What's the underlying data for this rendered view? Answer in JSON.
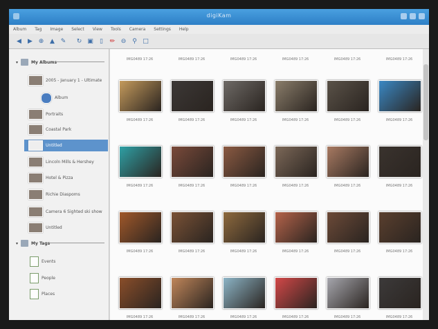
{
  "window": {
    "title": "digiKam"
  },
  "menu": [
    "Album",
    "Tag",
    "Image",
    "Select",
    "View",
    "Tools",
    "Camera",
    "Settings",
    "Help"
  ],
  "toolbar": [
    "back-icon",
    "forward-icon",
    "zoom-in-icon",
    "up-icon",
    "edit-icon",
    "rotate-icon",
    "crop-icon",
    "slideshow-icon",
    "red-eye-icon",
    "zoom-out-icon",
    "search-icon",
    "fullscreen-icon"
  ],
  "sidebar": {
    "albums_header": "My Albums",
    "albums": [
      {
        "label": "2005 - January 1 - Ultimate"
      },
      {
        "label": "Album"
      },
      {
        "label": "Portraits"
      },
      {
        "label": "Coastal Park"
      },
      {
        "label": "Untitled"
      },
      {
        "label": "Lincoln Mills & Hershey"
      },
      {
        "label": "Hotel & Pizza"
      },
      {
        "label": "Richie Diaspoms"
      },
      {
        "label": "Camera 6 Sighted ski show"
      },
      {
        "label": "Untitled"
      }
    ],
    "tags_header": "My Tags",
    "tags": [
      {
        "label": "Events"
      },
      {
        "label": "People"
      },
      {
        "label": "Places"
      }
    ]
  },
  "grid": {
    "caption": "IMG0489 17:26",
    "rows": [
      [
        "#c49a5c",
        "#3c3836",
        "#6e6a66",
        "#8a7d6a",
        "#5a5248",
        "#3a88c4"
      ],
      [
        "#2fa0a5",
        "#7a4a3a",
        "#8b5a42",
        "#7c6858",
        "#a87a62",
        "#3a332e"
      ],
      [
        "#a0582a",
        "#7a5236",
        "#8e6a3e",
        "#b4634a",
        "#6c4a38",
        "#5a3f2e"
      ],
      [
        "#8a4e2a",
        "#c0865a",
        "#8cb4c6",
        "#d24848",
        "#a6a6ad",
        "#3c3a3a"
      ]
    ]
  }
}
